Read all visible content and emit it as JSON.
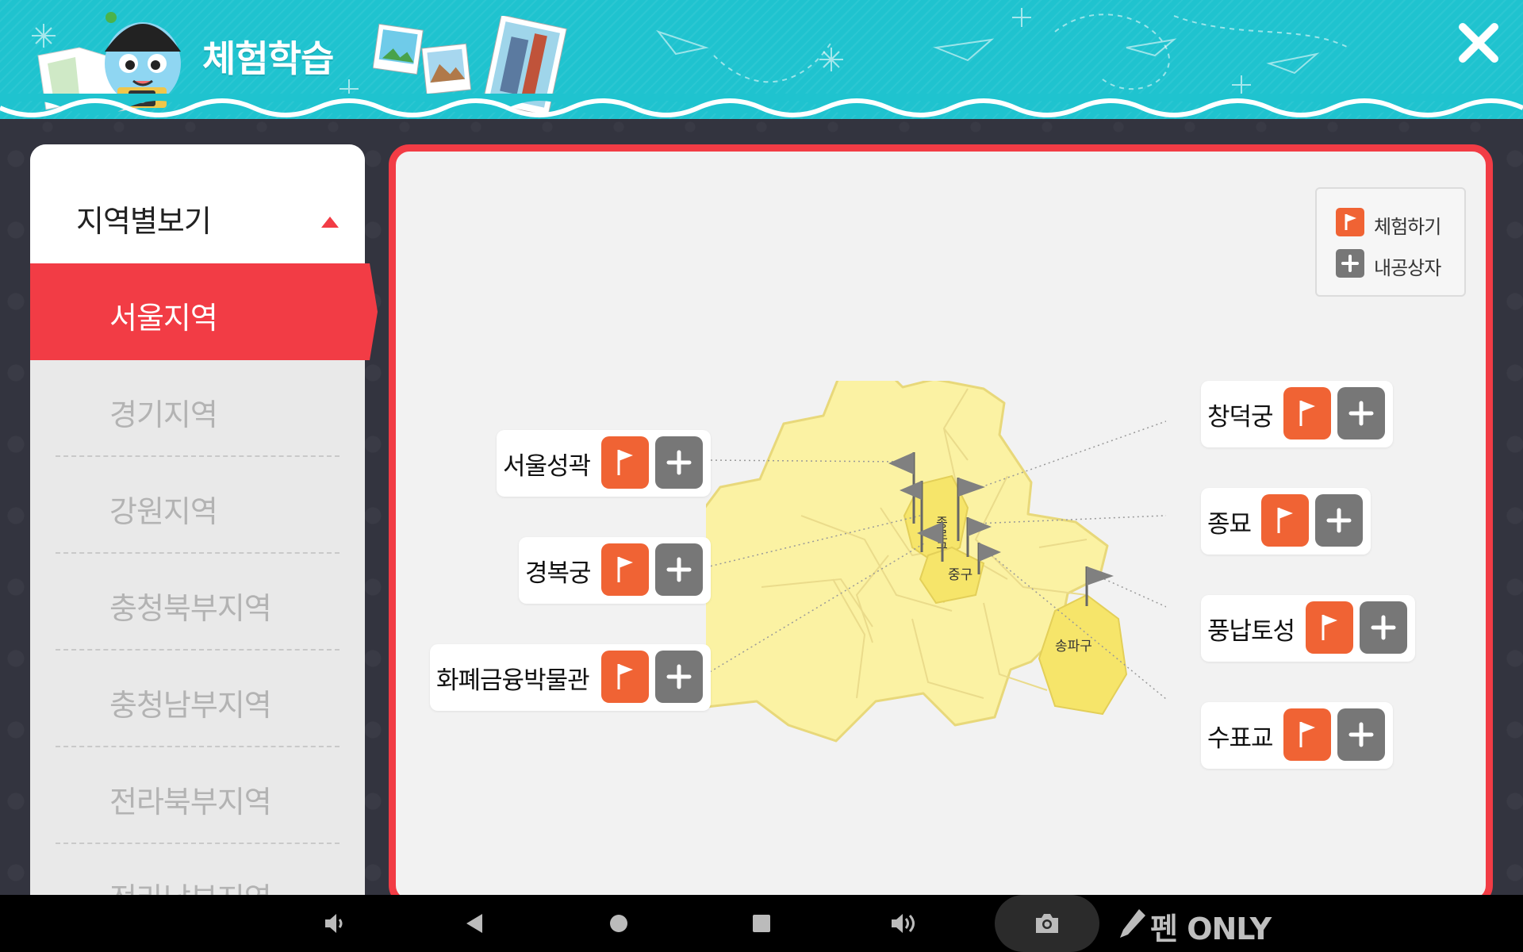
{
  "header": {
    "title": "체험학습"
  },
  "sidebar": {
    "title": "지역별보기",
    "items": [
      {
        "label": "서울지역"
      },
      {
        "label": "경기지역"
      },
      {
        "label": "강원지역"
      },
      {
        "label": "충청북부지역"
      },
      {
        "label": "충청남부지역"
      },
      {
        "label": "전라북부지역"
      },
      {
        "label": "전라남부지역"
      }
    ],
    "active_index": 0
  },
  "legend": {
    "experience_label": "체험하기",
    "storage_label": "내공상자"
  },
  "map": {
    "district_labels": [
      "종로구",
      "중구",
      "송파구"
    ]
  },
  "sites": {
    "left": [
      {
        "name": "서울성곽"
      },
      {
        "name": "경복궁"
      },
      {
        "name": "화폐금융박물관"
      }
    ],
    "right": [
      {
        "name": "창덕궁"
      },
      {
        "name": "종묘"
      },
      {
        "name": "풍납토성"
      },
      {
        "name": "수표교"
      }
    ]
  },
  "navbar": {
    "pen_label": "펜 ONLY"
  },
  "colors": {
    "accent": "#f23c45",
    "header": "#1fc3cf",
    "experience_button": "#f06334",
    "storage_button": "#777777",
    "map_fill": "#fbf2a3"
  },
  "icons": [
    "close-icon",
    "flag-icon",
    "plus-icon",
    "caret-up-icon",
    "volume-down-icon",
    "back-icon",
    "home-icon",
    "recents-icon",
    "volume-up-icon",
    "camera-icon",
    "pen-icon"
  ]
}
